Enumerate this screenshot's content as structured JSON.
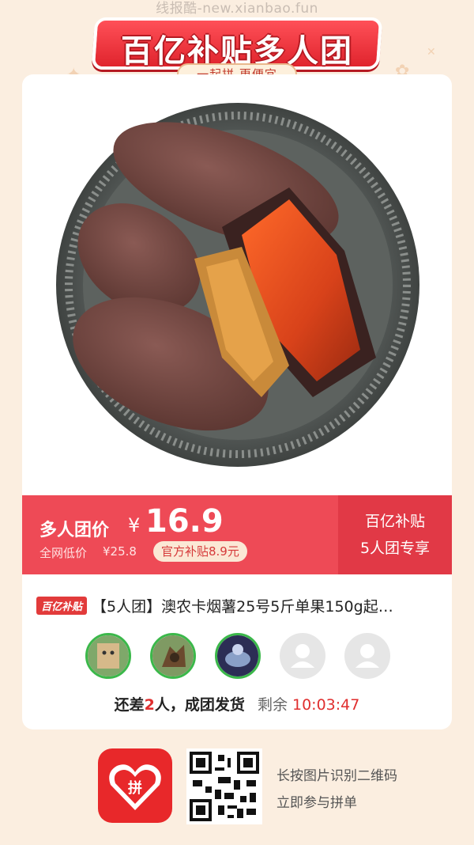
{
  "watermark": "线报酷-new.xianbao.fun",
  "banner": {
    "title": "百亿补贴多人团",
    "subtitle": "一起拼 更便宜"
  },
  "price": {
    "group_label": "多人团价",
    "currency": "¥",
    "value": "16.9",
    "market_label": "全网低价",
    "market_value": "¥25.8",
    "subsidy": "官方补贴8.9元",
    "side_line1": "百亿补贴",
    "side_line2": "5人团专享"
  },
  "product": {
    "tag": "百亿补贴",
    "title": "【5人团】澳农卡烟薯25号5斤单果150g起…"
  },
  "group": {
    "status_prefix": "还差",
    "missing_count": "2",
    "status_suffix": "人，成团发货",
    "remain_label": "剩余",
    "countdown": "10:03:47"
  },
  "footer": {
    "line1": "长按图片识别二维码",
    "line2": "立即参与拼单"
  },
  "colors": {
    "background": "#fbeee0",
    "primary_red": "#ee4a56",
    "dark_red": "#e13946",
    "avatar_ring": "#3bb84a"
  },
  "icons": [
    "sparkle-icon",
    "user-placeholder-icon",
    "pinduoduo-logo-icon",
    "qr-code-icon"
  ]
}
